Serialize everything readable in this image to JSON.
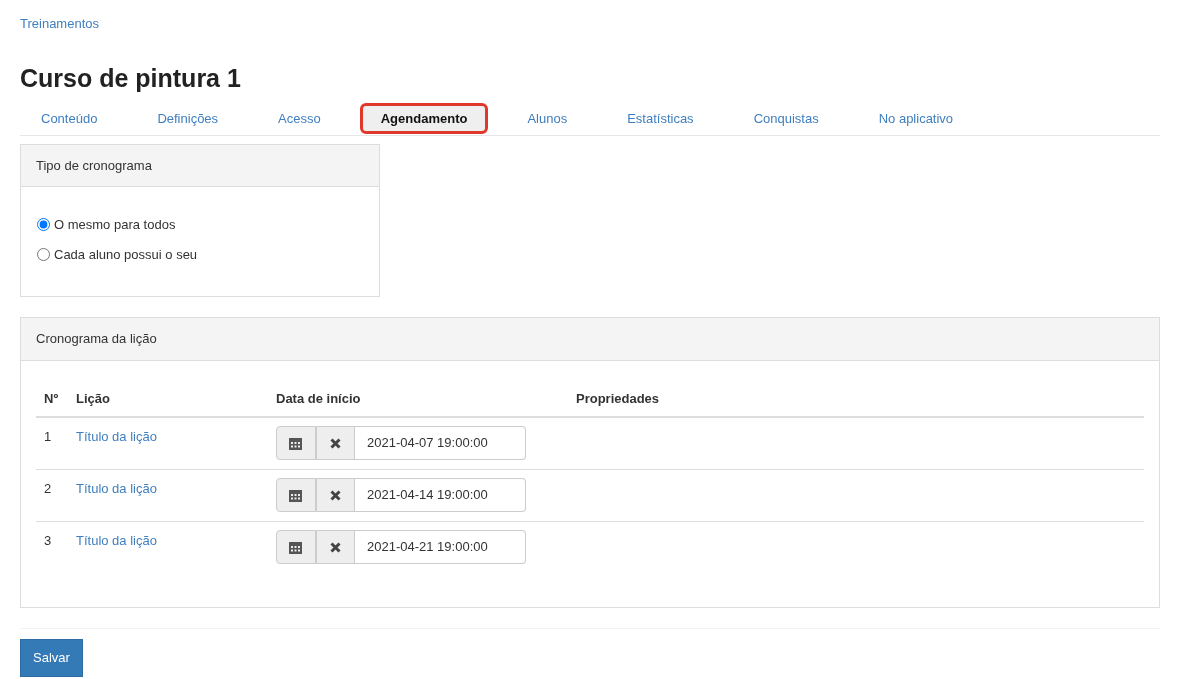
{
  "breadcrumb": "Treinamentos",
  "title": "Curso de pintura 1",
  "tabs": [
    {
      "label": "Conteúdo",
      "selected": false
    },
    {
      "label": "Definições",
      "selected": false
    },
    {
      "label": "Acesso",
      "selected": false
    },
    {
      "label": "Agendamento",
      "selected": true
    },
    {
      "label": "Alunos",
      "selected": false
    },
    {
      "label": "Estatísticas",
      "selected": false
    },
    {
      "label": "Conquistas",
      "selected": false
    },
    {
      "label": "No aplicativo",
      "selected": false
    }
  ],
  "schedule_type": {
    "heading": "Tipo de cronograma",
    "options": [
      {
        "label": "O mesmo para todos",
        "selected": true
      },
      {
        "label": "Cada aluno possui o seu",
        "selected": false
      }
    ]
  },
  "lesson_schedule": {
    "heading": "Cronograma da lição",
    "columns": [
      "Nº",
      "Lição",
      "Data de início",
      "Propriedades"
    ],
    "rows": [
      {
        "number": "1",
        "lesson": "Título da lição",
        "start_date": "2021-04-07 19:00:00"
      },
      {
        "number": "2",
        "lesson": "Título da lição",
        "start_date": "2021-04-14 19:00:00"
      },
      {
        "number": "3",
        "lesson": "Título da lição",
        "start_date": "2021-04-21 19:00:00"
      }
    ]
  },
  "save_button": "Salvar"
}
